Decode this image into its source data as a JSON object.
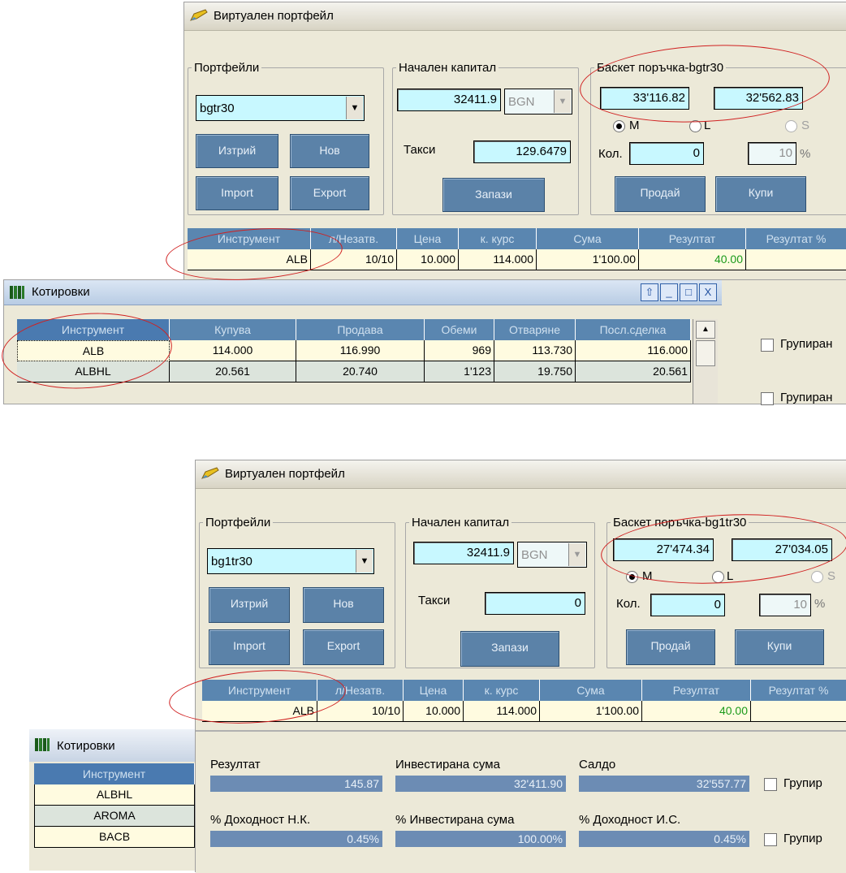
{
  "top": {
    "window_title": "Виртуален портфейл",
    "portfolios": {
      "legend": "Портфейли",
      "selected": "bgtr30",
      "delete_label": "Изтрий",
      "new_label": "Нов",
      "import_label": "Import",
      "export_label": "Export"
    },
    "capital": {
      "legend": "Начален капитал",
      "value": "32411.9",
      "currency": "BGN",
      "fees_label": "Такси",
      "fees_value": "129.6479",
      "save_label": "Запази"
    },
    "basket": {
      "legend": "Баскет поръчка-bgtr30",
      "value1": "33'116.82",
      "value2": "32'562.83",
      "m_label": "M",
      "l_label": "L",
      "s_label": "S",
      "qty_label": "Кол.",
      "qty_value": "0",
      "pct_value": "10",
      "pct_sign": "%",
      "sell_label": "Продай",
      "buy_label": "Купи"
    },
    "table": {
      "headers": [
        "Инструмент",
        "л/Незатв.",
        "Цена",
        "к. курс",
        "Сума",
        "Резултат",
        "Резултат %"
      ],
      "row": [
        "ALB",
        "10/10",
        "10.000",
        "114.000",
        "1'100.00",
        "40.00",
        ""
      ]
    }
  },
  "quotes_top": {
    "title": "Котировки",
    "headers": [
      "Инструмент",
      "Купува",
      "Продава",
      "Обеми",
      "Отваряне",
      "Посл.сделка"
    ],
    "rows": [
      [
        "ALB",
        "114.000",
        "116.990",
        "969",
        "113.730",
        "116.000"
      ],
      [
        "ALBHL",
        "20.561",
        "20.740",
        "1'123",
        "19.750",
        "20.561"
      ]
    ],
    "group_label": "Групиран",
    "group_label2": "Групиран"
  },
  "bottom": {
    "window_title": "Виртуален портфейл",
    "portfolios": {
      "legend": "Портфейли",
      "selected": "bg1tr30",
      "delete_label": "Изтрий",
      "new_label": "Нов",
      "import_label": "Import",
      "export_label": "Export"
    },
    "capital": {
      "legend": "Начален капитал",
      "value": "32411.9",
      "currency": "BGN",
      "fees_label": "Такси",
      "fees_value": "0",
      "save_label": "Запази"
    },
    "basket": {
      "legend": "Баскет поръчка-bg1tr30",
      "value1": "27'474.34",
      "value2": "27'034.05",
      "m_label": "M",
      "l_label": "L",
      "s_label": "S",
      "qty_label": "Кол.",
      "qty_value": "0",
      "pct_value": "10",
      "pct_sign": "%",
      "sell_label": "Продай",
      "buy_label": "Купи"
    },
    "table": {
      "headers": [
        "Инструмент",
        "л/Незатв.",
        "Цена",
        "к. курс",
        "Сума",
        "Резултат",
        "Резултат %"
      ],
      "row": [
        "ALB",
        "10/10",
        "10.000",
        "114.000",
        "1'100.00",
        "40.00",
        ""
      ]
    },
    "summary": {
      "result_label": "Резултат",
      "result_value": "145.87",
      "invested_label": "Инвестирана сума",
      "invested_value": "32'411.90",
      "balance_label": "Салдо",
      "balance_value": "32'557.77",
      "yield_nk_label": "% Доходност Н.К.",
      "yield_nk_value": "0.45%",
      "invested_pct_label": "% Инвестирана сума",
      "invested_pct_value": "100.00%",
      "yield_is_label": "% Доходност И.С.",
      "yield_is_value": "0.45%",
      "group_label": "Групир",
      "group_label2": "Групир"
    }
  },
  "quotes_bottom": {
    "title": "Котировки",
    "header": "Инструмент",
    "rows": [
      "ALBHL",
      "AROMA",
      "BACB"
    ]
  }
}
